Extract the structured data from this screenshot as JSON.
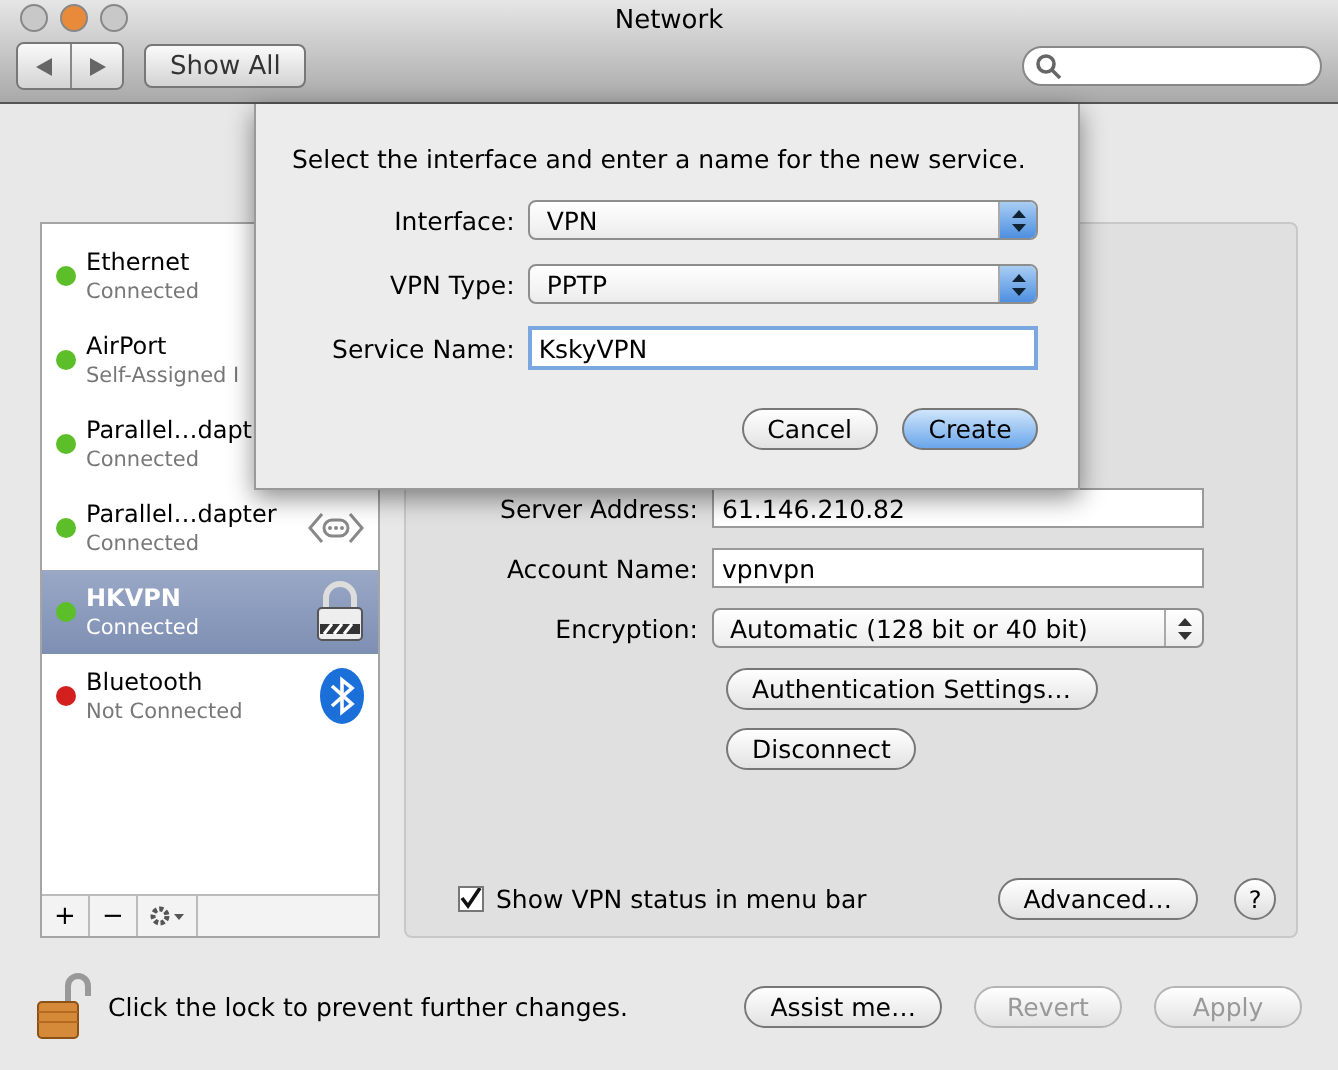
{
  "window": {
    "title": "Network"
  },
  "toolbar": {
    "show_all": "Show All"
  },
  "services": [
    {
      "kind": "covered",
      "name": "Ethernet",
      "status": "Connected",
      "color": "#5cbf2a",
      "selected": false
    },
    {
      "kind": "covered",
      "name": "AirPort",
      "status": "Self-Assigned I",
      "color": "#5cbf2a",
      "selected": false
    },
    {
      "kind": "covered",
      "name": "Parallel…dapt",
      "status": "Connected",
      "color": "#5cbf2a",
      "selected": false
    },
    {
      "kind": "ethernet",
      "name": "Parallel…dapter",
      "status": "Connected",
      "color": "#5cbf2a",
      "selected": false
    },
    {
      "kind": "vpn",
      "name": "HKVPN",
      "status": "Connected",
      "color": "#5cbf2a",
      "selected": true
    },
    {
      "kind": "bluetooth",
      "name": "Bluetooth",
      "status": "Not Connected",
      "color": "#d41f1f",
      "selected": false
    }
  ],
  "list_buttons": [
    "+",
    "−"
  ],
  "details": {
    "fields": [
      {
        "kind": "text",
        "label": "Server Address:",
        "value": "61.146.210.82"
      },
      {
        "kind": "text",
        "label": "Account Name:",
        "value": "vpnvpn"
      },
      {
        "kind": "popup",
        "label": "Encryption:",
        "value": "Automatic (128 bit or 40 bit)"
      }
    ],
    "buttons": [
      "Authentication Settings…",
      "Disconnect"
    ],
    "show_status": {
      "label": "Show VPN status in menu bar",
      "checked": true
    },
    "advanced": "Advanced…",
    "help": "?"
  },
  "footer": {
    "lock_text": "Click the lock to prevent further changes.",
    "buttons": [
      {
        "label": "Assist me…",
        "disabled": false
      },
      {
        "label": "Revert",
        "disabled": true
      },
      {
        "label": "Apply",
        "disabled": true
      }
    ]
  },
  "sheet": {
    "prompt": "Select the interface and enter a name for the new service.",
    "fields": [
      {
        "kind": "popup",
        "label": "Interface:",
        "value": "VPN"
      },
      {
        "kind": "popup",
        "label": "VPN Type:",
        "value": "PPTP"
      },
      {
        "kind": "text",
        "label": "Service Name:",
        "value": "KskyVPN"
      }
    ],
    "buttons": [
      {
        "label": "Cancel",
        "default": false
      },
      {
        "label": "Create",
        "default": true
      }
    ]
  }
}
